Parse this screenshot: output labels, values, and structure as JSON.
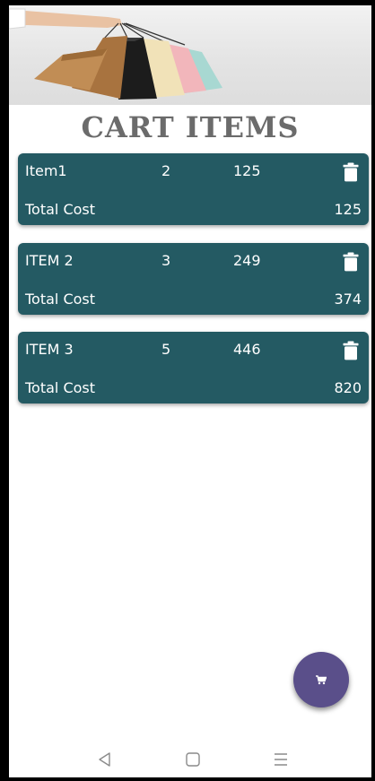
{
  "header": {
    "banner_image": "shopping-bags-banner",
    "title": "CART ITEMS"
  },
  "cart": {
    "total_label": "Total Cost",
    "items": [
      {
        "name": "Item1",
        "quantity": "2",
        "price": "125",
        "total": "125"
      },
      {
        "name": "ITEM 2",
        "quantity": "3",
        "price": "249",
        "total": "374"
      },
      {
        "name": "ITEM 3",
        "quantity": "5",
        "price": "446",
        "total": "820"
      }
    ]
  },
  "fab": {
    "icon": "cart-icon"
  },
  "navbar": {
    "icons": [
      "back-icon",
      "home-icon",
      "menu-icon"
    ]
  },
  "colors": {
    "card": "#245a63",
    "fab": "#5a4f8a",
    "title": "#6b6b6b"
  }
}
